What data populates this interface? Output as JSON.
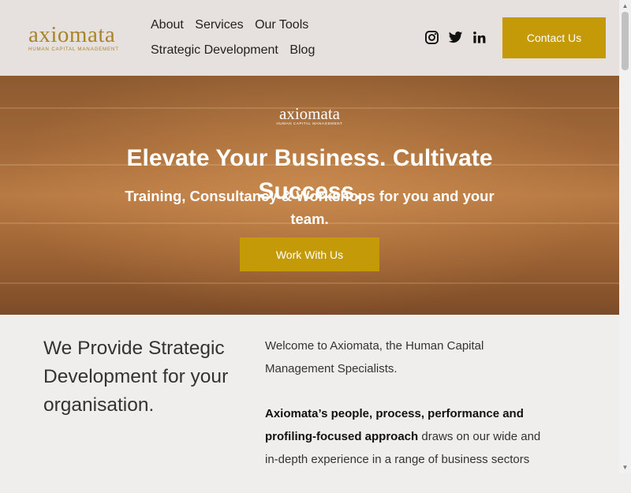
{
  "brand": {
    "name": "axiomata",
    "tagline": "HUMAN CAPITAL MANAGEMENT",
    "accent_color": "#c49a09"
  },
  "nav": {
    "row1": [
      "About",
      "Services",
      "Our Tools"
    ],
    "row2": [
      "Strategic Development",
      "Blog"
    ]
  },
  "socials": [
    "instagram-icon",
    "twitter-icon",
    "linkedin-icon"
  ],
  "header": {
    "contact_label": "Contact Us"
  },
  "hero": {
    "title_line1": "Elevate Your Business. Cultivate",
    "title_line2": "Success.",
    "subtitle": "Training, Consultancy & Workshops for you and your team.",
    "button_label": "Work With Us"
  },
  "content": {
    "heading": "We Provide Strategic Development for your organisation.",
    "para1": "Welcome to Axiomata, the Human Capital Management Specialists.",
    "para2_bold": "Axiomata’s people, process, performance and profiling-focused approach",
    "para2_rest": " draws on our wide and in-depth experience in a range of business sectors"
  }
}
